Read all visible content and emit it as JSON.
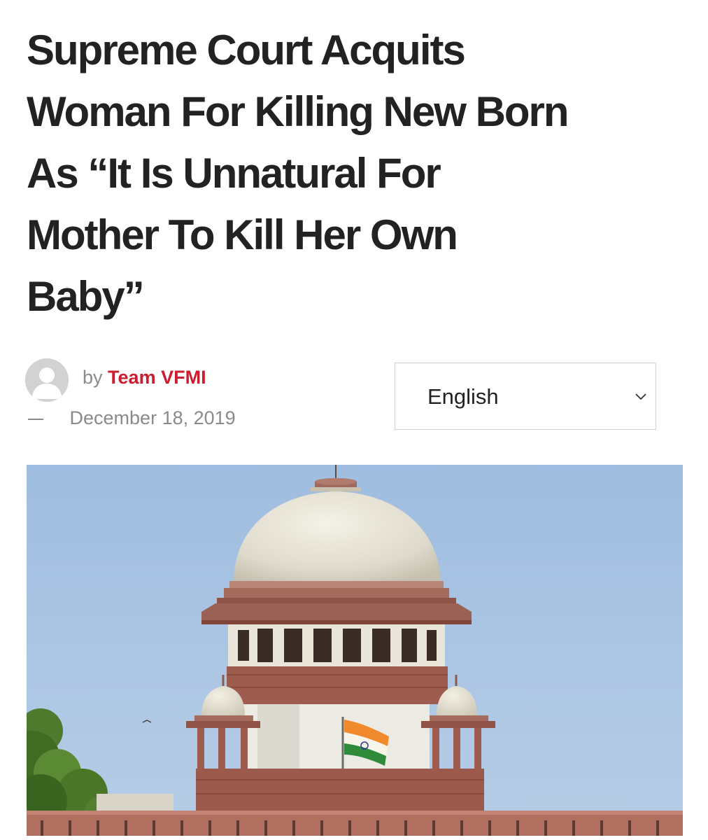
{
  "article": {
    "headline_lines": [
      "Supreme Court Acquits",
      "Woman For Killing New Born",
      "As “It Is Unnatural For",
      "Mother To Kill Her Own",
      "Baby”"
    ],
    "by_label": "by",
    "author": "Team VFMI",
    "date": "December 18, 2019"
  },
  "language_select": {
    "selected": "English"
  },
  "icons": {
    "avatar": "user-avatar-placeholder-icon",
    "dropdown": "chevron-down-icon"
  },
  "colors": {
    "author_link": "#cc1c2d",
    "headline": "#222222",
    "meta_text": "#8a8a8a",
    "sky": "#a3bfe0"
  }
}
